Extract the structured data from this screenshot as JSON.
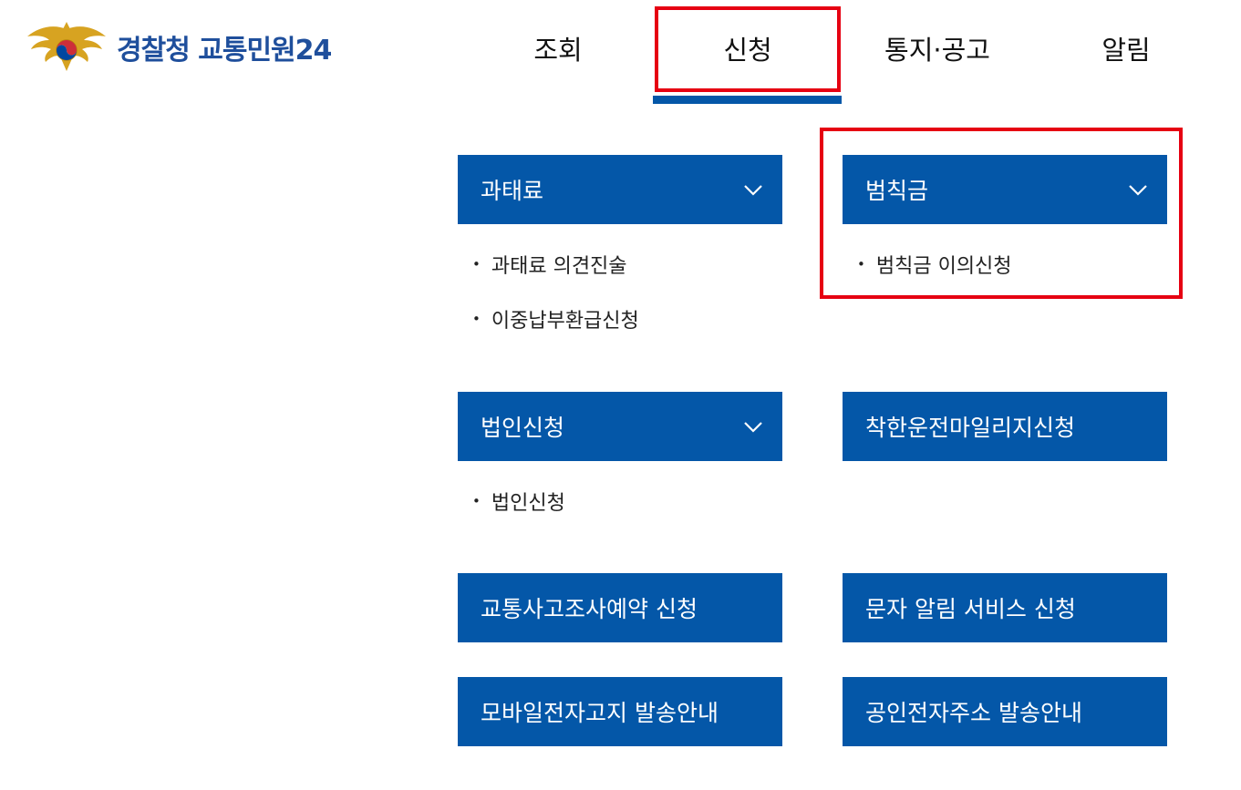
{
  "header": {
    "logo_text": "경찰청 교통민원24",
    "nav": [
      {
        "label": "조회"
      },
      {
        "label": "신청"
      },
      {
        "label": "통지·공고"
      },
      {
        "label": "알림"
      }
    ]
  },
  "menu": {
    "sections": [
      {
        "title": "과태료",
        "items": [
          "과태료 의견진술",
          "이중납부환급신청"
        ]
      },
      {
        "title": "범칙금",
        "items": [
          "범칙금 이의신청"
        ]
      },
      {
        "title": "법인신청",
        "items": [
          "법인신청"
        ]
      },
      {
        "title": "착한운전마일리지신청",
        "items": []
      },
      {
        "title": "교통사고조사예약 신청",
        "items": []
      },
      {
        "title": "문자 알림 서비스 신청",
        "items": []
      },
      {
        "title": "모바일전자고지 발송안내",
        "items": []
      },
      {
        "title": "공인전자주소 발송안내",
        "items": []
      }
    ]
  },
  "colors": {
    "primary": "#0457a8",
    "highlight": "#e60012",
    "brand_text": "#1f4f9c"
  }
}
